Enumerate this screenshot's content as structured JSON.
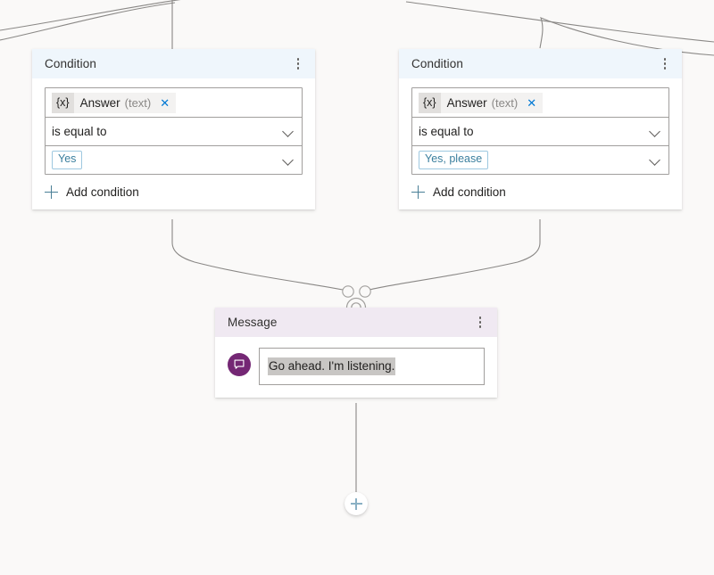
{
  "canvas": {
    "background_color": "#faf9f8",
    "connector_color": "#8a8886"
  },
  "nodes": [
    {
      "id": "condition-left",
      "type": "condition",
      "title": "Condition",
      "header_color": "#eff6fc",
      "menu_icon": "kebab-menu-icon",
      "variable": {
        "brace": "{x}",
        "name": "Answer",
        "type": "(text)",
        "clear_icon": "✕"
      },
      "operator": "is equal to",
      "value": "Yes",
      "add_condition_label": "Add condition"
    },
    {
      "id": "condition-right",
      "type": "condition",
      "title": "Condition",
      "header_color": "#eff6fc",
      "menu_icon": "kebab-menu-icon",
      "variable": {
        "brace": "{x}",
        "name": "Answer",
        "type": "(text)",
        "clear_icon": "✕"
      },
      "operator": "is equal to",
      "value": "Yes, please",
      "add_condition_label": "Add condition"
    },
    {
      "id": "message",
      "type": "message",
      "title": "Message",
      "header_color": "#f0e9f2",
      "menu_icon": "kebab-menu-icon",
      "avatar_icon": "chat-bubble-icon",
      "avatar_color": "#742774",
      "text": "Go ahead. I'm listening.",
      "text_selected": true
    }
  ],
  "merge_node": {
    "name": "merge-connector-node",
    "accent_color": "#a19f9d"
  },
  "add_step_button": {
    "name": "add-step-button",
    "icon": "plus-icon",
    "color": "#8ab0c4"
  }
}
